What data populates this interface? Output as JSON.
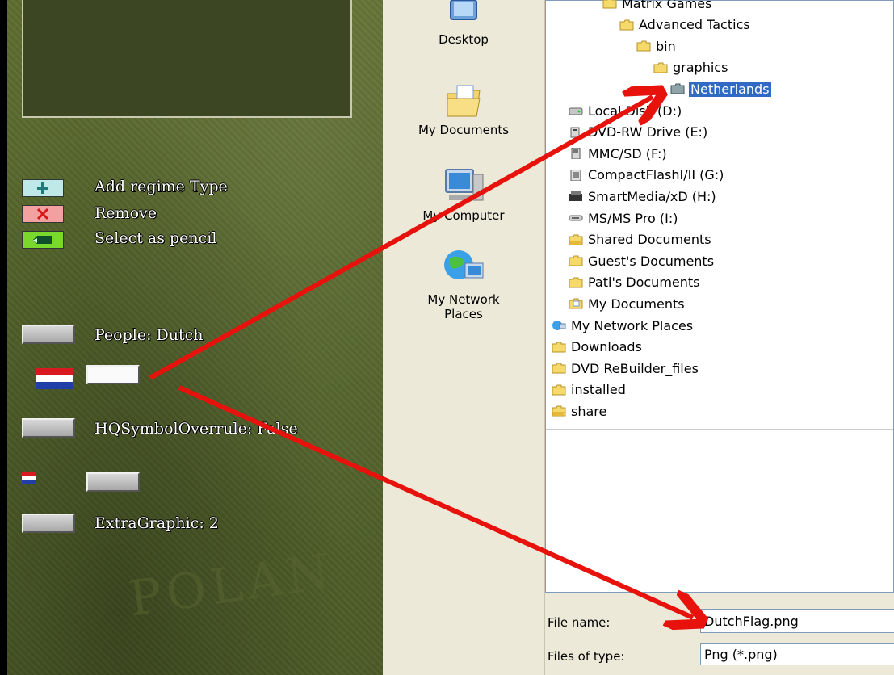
{
  "game": {
    "actions": {
      "add_label": "Add regime Type",
      "remove_label": "Remove",
      "pencil_label": "Select as pencil"
    },
    "properties": {
      "people": "People: Dutch",
      "hq_symbol": "HQSymbolOverrule: False",
      "extra_graphic": "ExtraGraphic: 2"
    },
    "flag_colors": [
      "#d8191f",
      "#ffffff",
      "#1f3ea8"
    ],
    "bg_text": "POLAN"
  },
  "dialog": {
    "places": [
      {
        "icon": "desktop-icon",
        "label": "Desktop"
      },
      {
        "icon": "my-documents-icon",
        "label": "My Documents"
      },
      {
        "icon": "my-computer-icon",
        "label": "My Computer"
      },
      {
        "icon": "my-network-places-icon",
        "label": "My Network Places"
      }
    ],
    "tree": [
      {
        "icon": "folder-icon",
        "label": "Matrix Games",
        "indent": 3
      },
      {
        "icon": "folder-icon",
        "label": "Advanced Tactics",
        "indent": 4
      },
      {
        "icon": "folder-icon",
        "label": "bin",
        "indent": 5
      },
      {
        "icon": "folder-icon",
        "label": "graphics",
        "indent": 6
      },
      {
        "icon": "folder-open-icon",
        "label": "Netherlands",
        "indent": 7,
        "selected": true
      },
      {
        "icon": "hard-disk-icon",
        "label": "Local Disk (D:)",
        "indent": 1
      },
      {
        "icon": "dvd-drive-icon",
        "label": "DVD-RW Drive (E:)",
        "indent": 1
      },
      {
        "icon": "sd-card-icon",
        "label": "MMC/SD (F:)",
        "indent": 1
      },
      {
        "icon": "compactflash-icon",
        "label": "CompactFlashI/II (G:)",
        "indent": 1
      },
      {
        "icon": "smartmedia-icon",
        "label": "SmartMedia/xD (H:)",
        "indent": 1
      },
      {
        "icon": "memory-stick-icon",
        "label": "MS/MS Pro (I:)",
        "indent": 1
      },
      {
        "icon": "shared-folder-icon",
        "label": "Shared Documents",
        "indent": 1
      },
      {
        "icon": "folder-icon",
        "label": "Guest's Documents",
        "indent": 1
      },
      {
        "icon": "folder-icon",
        "label": "Pati's Documents",
        "indent": 1
      },
      {
        "icon": "documents-folder-icon",
        "label": "My Documents",
        "indent": 1
      },
      {
        "icon": "network-places-icon",
        "label": "My Network Places",
        "indent": 0
      },
      {
        "icon": "folder-icon",
        "label": "Downloads",
        "indent": 0
      },
      {
        "icon": "folder-icon",
        "label": "DVD ReBuilder_files",
        "indent": 0
      },
      {
        "icon": "folder-icon",
        "label": "installed",
        "indent": 0
      },
      {
        "icon": "shared-folder-icon",
        "label": "share",
        "indent": 0
      }
    ],
    "file_name_label": "File name:",
    "file_name_value": "DutchFlag.png",
    "file_type_label": "Files of type:",
    "file_type_value": "Png (*.png)",
    "colors": {
      "selection": "#316ac5",
      "arrow": "#e8120c"
    }
  }
}
